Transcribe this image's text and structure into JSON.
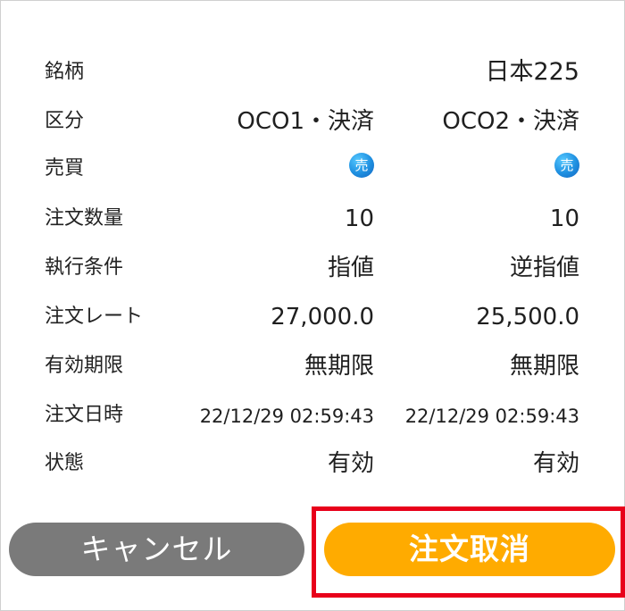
{
  "rows": {
    "symbol": {
      "label": "銘柄",
      "value": "日本225"
    },
    "category": {
      "label": "区分",
      "oco1": "OCO1・決済",
      "oco2": "OCO2・決済"
    },
    "side": {
      "label": "売買",
      "oco1_icon": "売",
      "oco2_icon": "売"
    },
    "quantity": {
      "label": "注文数量",
      "oco1": "10",
      "oco2": "10"
    },
    "condition": {
      "label": "執行条件",
      "oco1": "指値",
      "oco2": "逆指値"
    },
    "rate": {
      "label": "注文レート",
      "oco1": "27,000.0",
      "oco2": "25,500.0"
    },
    "expiry": {
      "label": "有効期限",
      "oco1": "無期限",
      "oco2": "無期限"
    },
    "datetime": {
      "label": "注文日時",
      "oco1": "22/12/29 02:59:43",
      "oco2": "22/12/29 02:59:43"
    },
    "status": {
      "label": "状態",
      "oco1": "有効",
      "oco2": "有効"
    }
  },
  "buttons": {
    "cancel": "キャンセル",
    "cancel_order": "注文取消"
  },
  "colors": {
    "cancel_button": "#7a7a7a",
    "submit_button": "#ffab00",
    "highlight": "#e8001a",
    "sell_badge": "#1e8fe0"
  }
}
